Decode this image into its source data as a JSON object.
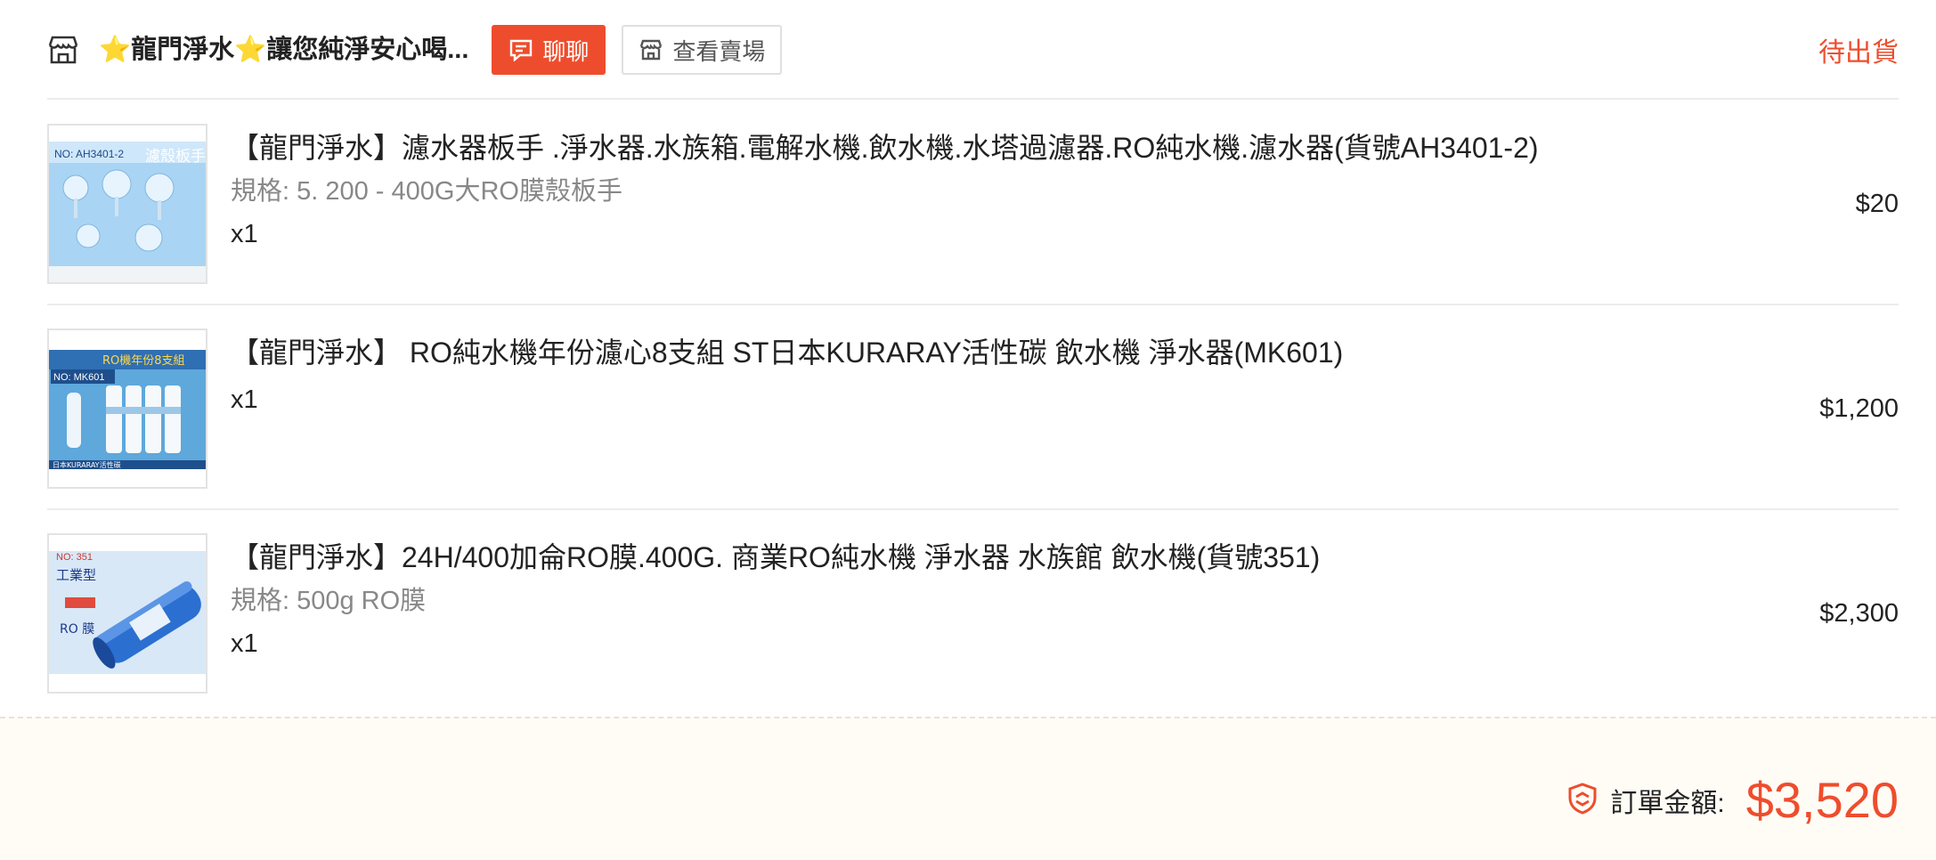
{
  "header": {
    "shop_name": "⭐龍門淨水⭐讓您純淨安心喝...",
    "chat_label": "聊聊",
    "view_shop_label": "查看賣場",
    "status": "待出貨"
  },
  "items": [
    {
      "title": "【龍門淨水】濾水器板手 .淨水器.水族箱.電解水機.飲水機.水塔過濾器.RO純水機.濾水器(貨號AH3401-2)",
      "variation": "規格: 5. 200 - 400G大RO膜殼板手",
      "qty": "x1",
      "price": "$20",
      "thumb_code": "NO: AH3401-2",
      "thumb_heading": "濾殼板手"
    },
    {
      "title": "【龍門淨水】 RO純水機年份濾心8支組 ST日本KURARAY活性碳 飲水機 淨水器(MK601)",
      "qty": "x1",
      "price": "$1,200",
      "thumb_code": "NO: MK601",
      "thumb_heading": "RO機年份8支組",
      "thumb_footer": "日本KURARAY活性碳"
    },
    {
      "title": "【龍門淨水】24H/400加侖RO膜.400G. 商業RO純水機 淨水器 水族館 飲水機(貨號351)",
      "variation": "規格: 500g RO膜",
      "qty": "x1",
      "price": "$2,300",
      "thumb_code": "NO: 351",
      "thumb_heading": "工業型",
      "thumb_sub": "RO 膜"
    }
  ],
  "footer": {
    "total_label": "訂單金額:",
    "total_amount": "$3,520"
  },
  "colors": {
    "accent": "#ee4d2d",
    "footer_bg": "#fffcf6"
  },
  "icons": [
    "shop-icon",
    "chat-icon",
    "storefront-icon",
    "shield-icon"
  ]
}
